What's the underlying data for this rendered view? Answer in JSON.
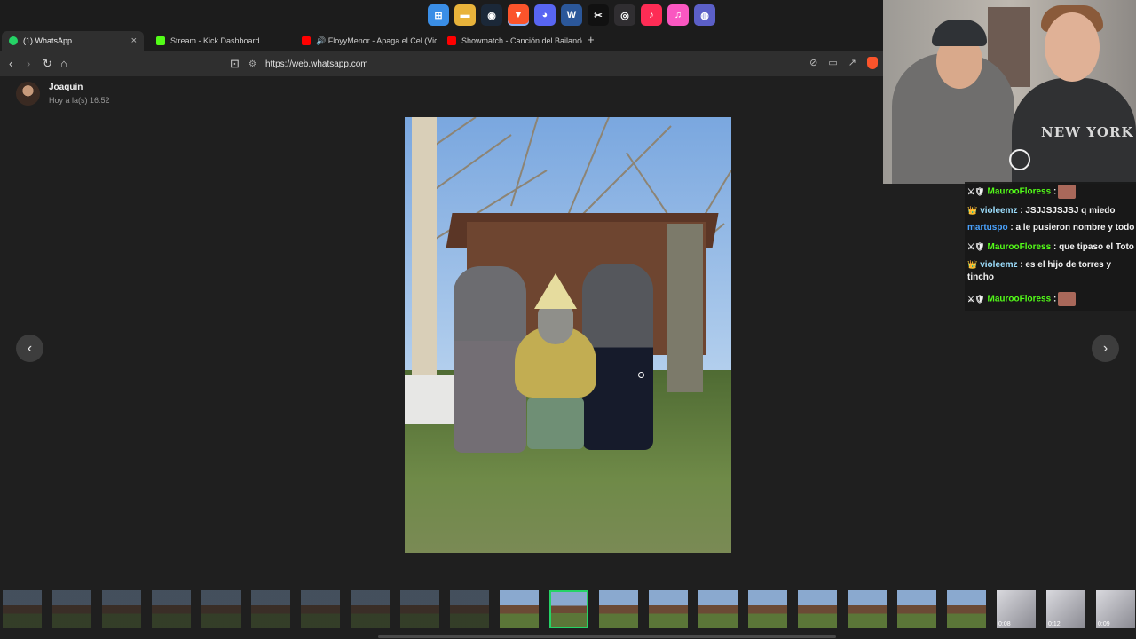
{
  "taskbar": {
    "icons": [
      {
        "name": "windows-start-icon",
        "glyph": "⊞",
        "color": "#3a8ee6"
      },
      {
        "name": "file-explorer-icon",
        "glyph": "▬",
        "color": "#e8b33b"
      },
      {
        "name": "steam-icon",
        "glyph": "◉",
        "color": "#1b2838"
      },
      {
        "name": "brave-icon",
        "glyph": "▼",
        "color": "#fb542b"
      },
      {
        "name": "discord-icon",
        "glyph": "◕",
        "color": "#5865f2"
      },
      {
        "name": "word-icon",
        "glyph": "W",
        "color": "#2b579a"
      },
      {
        "name": "capcut-icon",
        "glyph": "✂",
        "color": "#111111"
      },
      {
        "name": "obs-icon",
        "glyph": "◎",
        "color": "#302e31"
      },
      {
        "name": "tiktok-icon",
        "glyph": "♪",
        "color": "#fe2c55"
      },
      {
        "name": "itunes-icon",
        "glyph": "♫",
        "color": "#fa57c1"
      },
      {
        "name": "app-icon",
        "glyph": "◍",
        "color": "#5b5fc7"
      }
    ]
  },
  "tabs": [
    {
      "label": "(1) WhatsApp",
      "favicon_color": "#25d366",
      "active": true
    },
    {
      "label": "Stream - Kick Dashboard",
      "favicon_color": "#53fc18",
      "active": false
    },
    {
      "label": "🔊 FloyyMenor - Apaga el Cel (Video",
      "favicon_color": "#ff0000",
      "active": false
    },
    {
      "label": "Showmatch - Canción del Bailando (I",
      "favicon_color": "#ff0000",
      "active": false
    }
  ],
  "newtab_label": "+",
  "close_glyph": "×",
  "nav": {
    "back": "‹",
    "forward": "›",
    "reload": "↻",
    "home": "⌂",
    "bookmark": "⊡"
  },
  "address": {
    "url": "https://web.whatsapp.com"
  },
  "viewer": {
    "sender": "Joaquin",
    "time": "Hoy a la(s) 16:52",
    "prev_glyph": "‹",
    "next_glyph": "›"
  },
  "webcam": {
    "shirt_text": "NEW YORK"
  },
  "chat": {
    "messages": [
      {
        "badge": "⚔🛡",
        "user": "MaurooFloress",
        "user_color": "#53fc18",
        "sep": " :",
        "text": "",
        "emote": true
      },
      {
        "badge": "👑",
        "user": "violeemz",
        "user_color": "#9ee0ff",
        "sep": " :",
        "text": " JSJJSJSJSJ q miedo",
        "emote": false
      },
      {
        "badge": "",
        "user": "martuspo",
        "user_color": "#4aa3ff",
        "sep": " :",
        "text": " a le pusieron nombre y todo",
        "emote": false
      },
      {
        "badge": "⚔🛡",
        "user": "MaurooFloress",
        "user_color": "#53fc18",
        "sep": " :",
        "text": " que tipaso el Toto",
        "emote": false
      },
      {
        "badge": "👑",
        "user": "violeemz",
        "user_color": "#9ee0ff",
        "sep": " :",
        "text": " es el hijo de torres y tincho",
        "emote": false
      },
      {
        "badge": "⚔🛡",
        "user": "MaurooFloress",
        "user_color": "#53fc18",
        "sep": " :",
        "text": "",
        "emote": true
      }
    ]
  },
  "thumbnails": {
    "items": [
      {
        "type": "photo",
        "state": "dim"
      },
      {
        "type": "photo",
        "state": "dim"
      },
      {
        "type": "photo",
        "state": "dim"
      },
      {
        "type": "photo",
        "state": "dim"
      },
      {
        "type": "photo",
        "state": "dim"
      },
      {
        "type": "photo",
        "state": "dim"
      },
      {
        "type": "photo",
        "state": "dim"
      },
      {
        "type": "photo",
        "state": "dim"
      },
      {
        "type": "photo",
        "state": "dim"
      },
      {
        "type": "photo",
        "state": "dim"
      },
      {
        "type": "photo",
        "state": "normal"
      },
      {
        "type": "photo",
        "state": "selected"
      },
      {
        "type": "photo",
        "state": "normal"
      },
      {
        "type": "photo",
        "state": "normal"
      },
      {
        "type": "photo",
        "state": "normal"
      },
      {
        "type": "photo",
        "state": "normal"
      },
      {
        "type": "photo",
        "state": "normal"
      },
      {
        "type": "photo",
        "state": "normal"
      },
      {
        "type": "photo",
        "state": "normal"
      },
      {
        "type": "photo",
        "state": "normal"
      },
      {
        "type": "video",
        "state": "normal",
        "duration": "0:08"
      },
      {
        "type": "video",
        "state": "normal",
        "duration": "0:12"
      },
      {
        "type": "video",
        "state": "normal",
        "duration": "0:09"
      }
    ]
  }
}
